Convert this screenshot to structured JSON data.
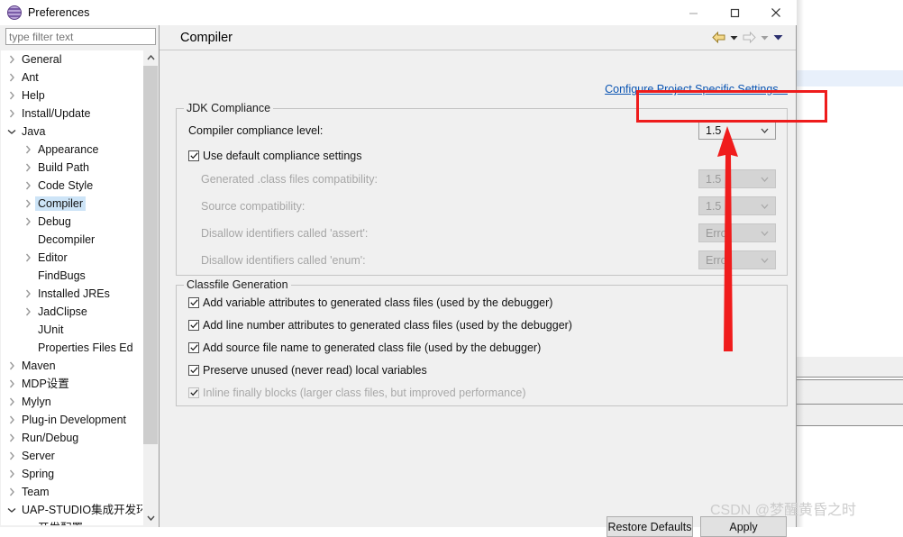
{
  "window": {
    "title": "Preferences",
    "icon": "eclipse-icon",
    "controls": {
      "minimize": "minimize-icon",
      "maximize": "maximize-icon",
      "close": "close-icon"
    }
  },
  "filter": {
    "placeholder": "type filter text",
    "value": ""
  },
  "tree": {
    "items": [
      {
        "label": "General",
        "indent": 0,
        "state": "collapsed"
      },
      {
        "label": "Ant",
        "indent": 0,
        "state": "collapsed"
      },
      {
        "label": "Help",
        "indent": 0,
        "state": "collapsed"
      },
      {
        "label": "Install/Update",
        "indent": 0,
        "state": "collapsed"
      },
      {
        "label": "Java",
        "indent": 0,
        "state": "expanded"
      },
      {
        "label": "Appearance",
        "indent": 1,
        "state": "collapsed"
      },
      {
        "label": "Build Path",
        "indent": 1,
        "state": "collapsed"
      },
      {
        "label": "Code Style",
        "indent": 1,
        "state": "collapsed"
      },
      {
        "label": "Compiler",
        "indent": 1,
        "state": "collapsed",
        "selected": true
      },
      {
        "label": "Debug",
        "indent": 1,
        "state": "collapsed"
      },
      {
        "label": "Decompiler",
        "indent": 1,
        "state": "leaf"
      },
      {
        "label": "Editor",
        "indent": 1,
        "state": "collapsed"
      },
      {
        "label": "FindBugs",
        "indent": 1,
        "state": "leaf"
      },
      {
        "label": "Installed JREs",
        "indent": 1,
        "state": "collapsed"
      },
      {
        "label": "JadClipse",
        "indent": 1,
        "state": "collapsed"
      },
      {
        "label": "JUnit",
        "indent": 1,
        "state": "leaf"
      },
      {
        "label": "Properties Files Ed",
        "indent": 1,
        "state": "leaf"
      },
      {
        "label": "Maven",
        "indent": 0,
        "state": "collapsed"
      },
      {
        "label": "MDP设置",
        "indent": 0,
        "state": "collapsed"
      },
      {
        "label": "Mylyn",
        "indent": 0,
        "state": "collapsed"
      },
      {
        "label": "Plug-in Development",
        "indent": 0,
        "state": "collapsed"
      },
      {
        "label": "Run/Debug",
        "indent": 0,
        "state": "collapsed"
      },
      {
        "label": "Server",
        "indent": 0,
        "state": "collapsed"
      },
      {
        "label": "Spring",
        "indent": 0,
        "state": "collapsed"
      },
      {
        "label": "Team",
        "indent": 0,
        "state": "collapsed"
      },
      {
        "label": "UAP-STUDIO集成开发环",
        "indent": 0,
        "state": "expanded"
      },
      {
        "label": "开发配置",
        "indent": 1,
        "state": "leaf"
      }
    ]
  },
  "page": {
    "title": "Compiler",
    "nav": {
      "back_icon": "back-arrow-icon",
      "back_menu_icon": "chevron-down-icon",
      "forward_icon": "forward-arrow-icon",
      "forward_menu_icon": "chevron-down-icon",
      "menu_icon": "chevron-down-icon"
    },
    "configure_link": "Configure Project Specific Settings...",
    "jdk_group": {
      "title": "JDK Compliance",
      "compliance_label": "Compiler compliance level:",
      "compliance_value": "1.5",
      "use_default_label": "Use default compliance settings",
      "use_default_checked": true,
      "rows": [
        {
          "label": "Generated .class files compatibility:",
          "value": "1.5",
          "disabled": true
        },
        {
          "label": "Source compatibility:",
          "value": "1.5",
          "disabled": true
        },
        {
          "label": "Disallow identifiers called 'assert':",
          "value": "Error",
          "disabled": true
        },
        {
          "label": "Disallow identifiers called 'enum':",
          "value": "Error",
          "disabled": true
        }
      ]
    },
    "classfile_group": {
      "title": "Classfile Generation",
      "items": [
        {
          "label": "Add variable attributes to generated class files (used by the debugger)",
          "checked": true,
          "disabled": false
        },
        {
          "label": "Add line number attributes to generated class files (used by the debugger)",
          "checked": true,
          "disabled": false
        },
        {
          "label": "Add source file name to generated class file (used by the debugger)",
          "checked": true,
          "disabled": false
        },
        {
          "label": "Preserve unused (never read) local variables",
          "checked": true,
          "disabled": false
        },
        {
          "label": "Inline finally blocks (larger class files, but improved performance)",
          "checked": true,
          "disabled": true
        }
      ]
    }
  },
  "buttons": {
    "restore_defaults": "Restore Defaults",
    "apply": "Apply"
  },
  "annotations": {
    "highlight_box_color": "#ee1c1c",
    "arrow_color": "#f01c1c",
    "watermark": "CSDN @梦醒黄昏之时"
  }
}
